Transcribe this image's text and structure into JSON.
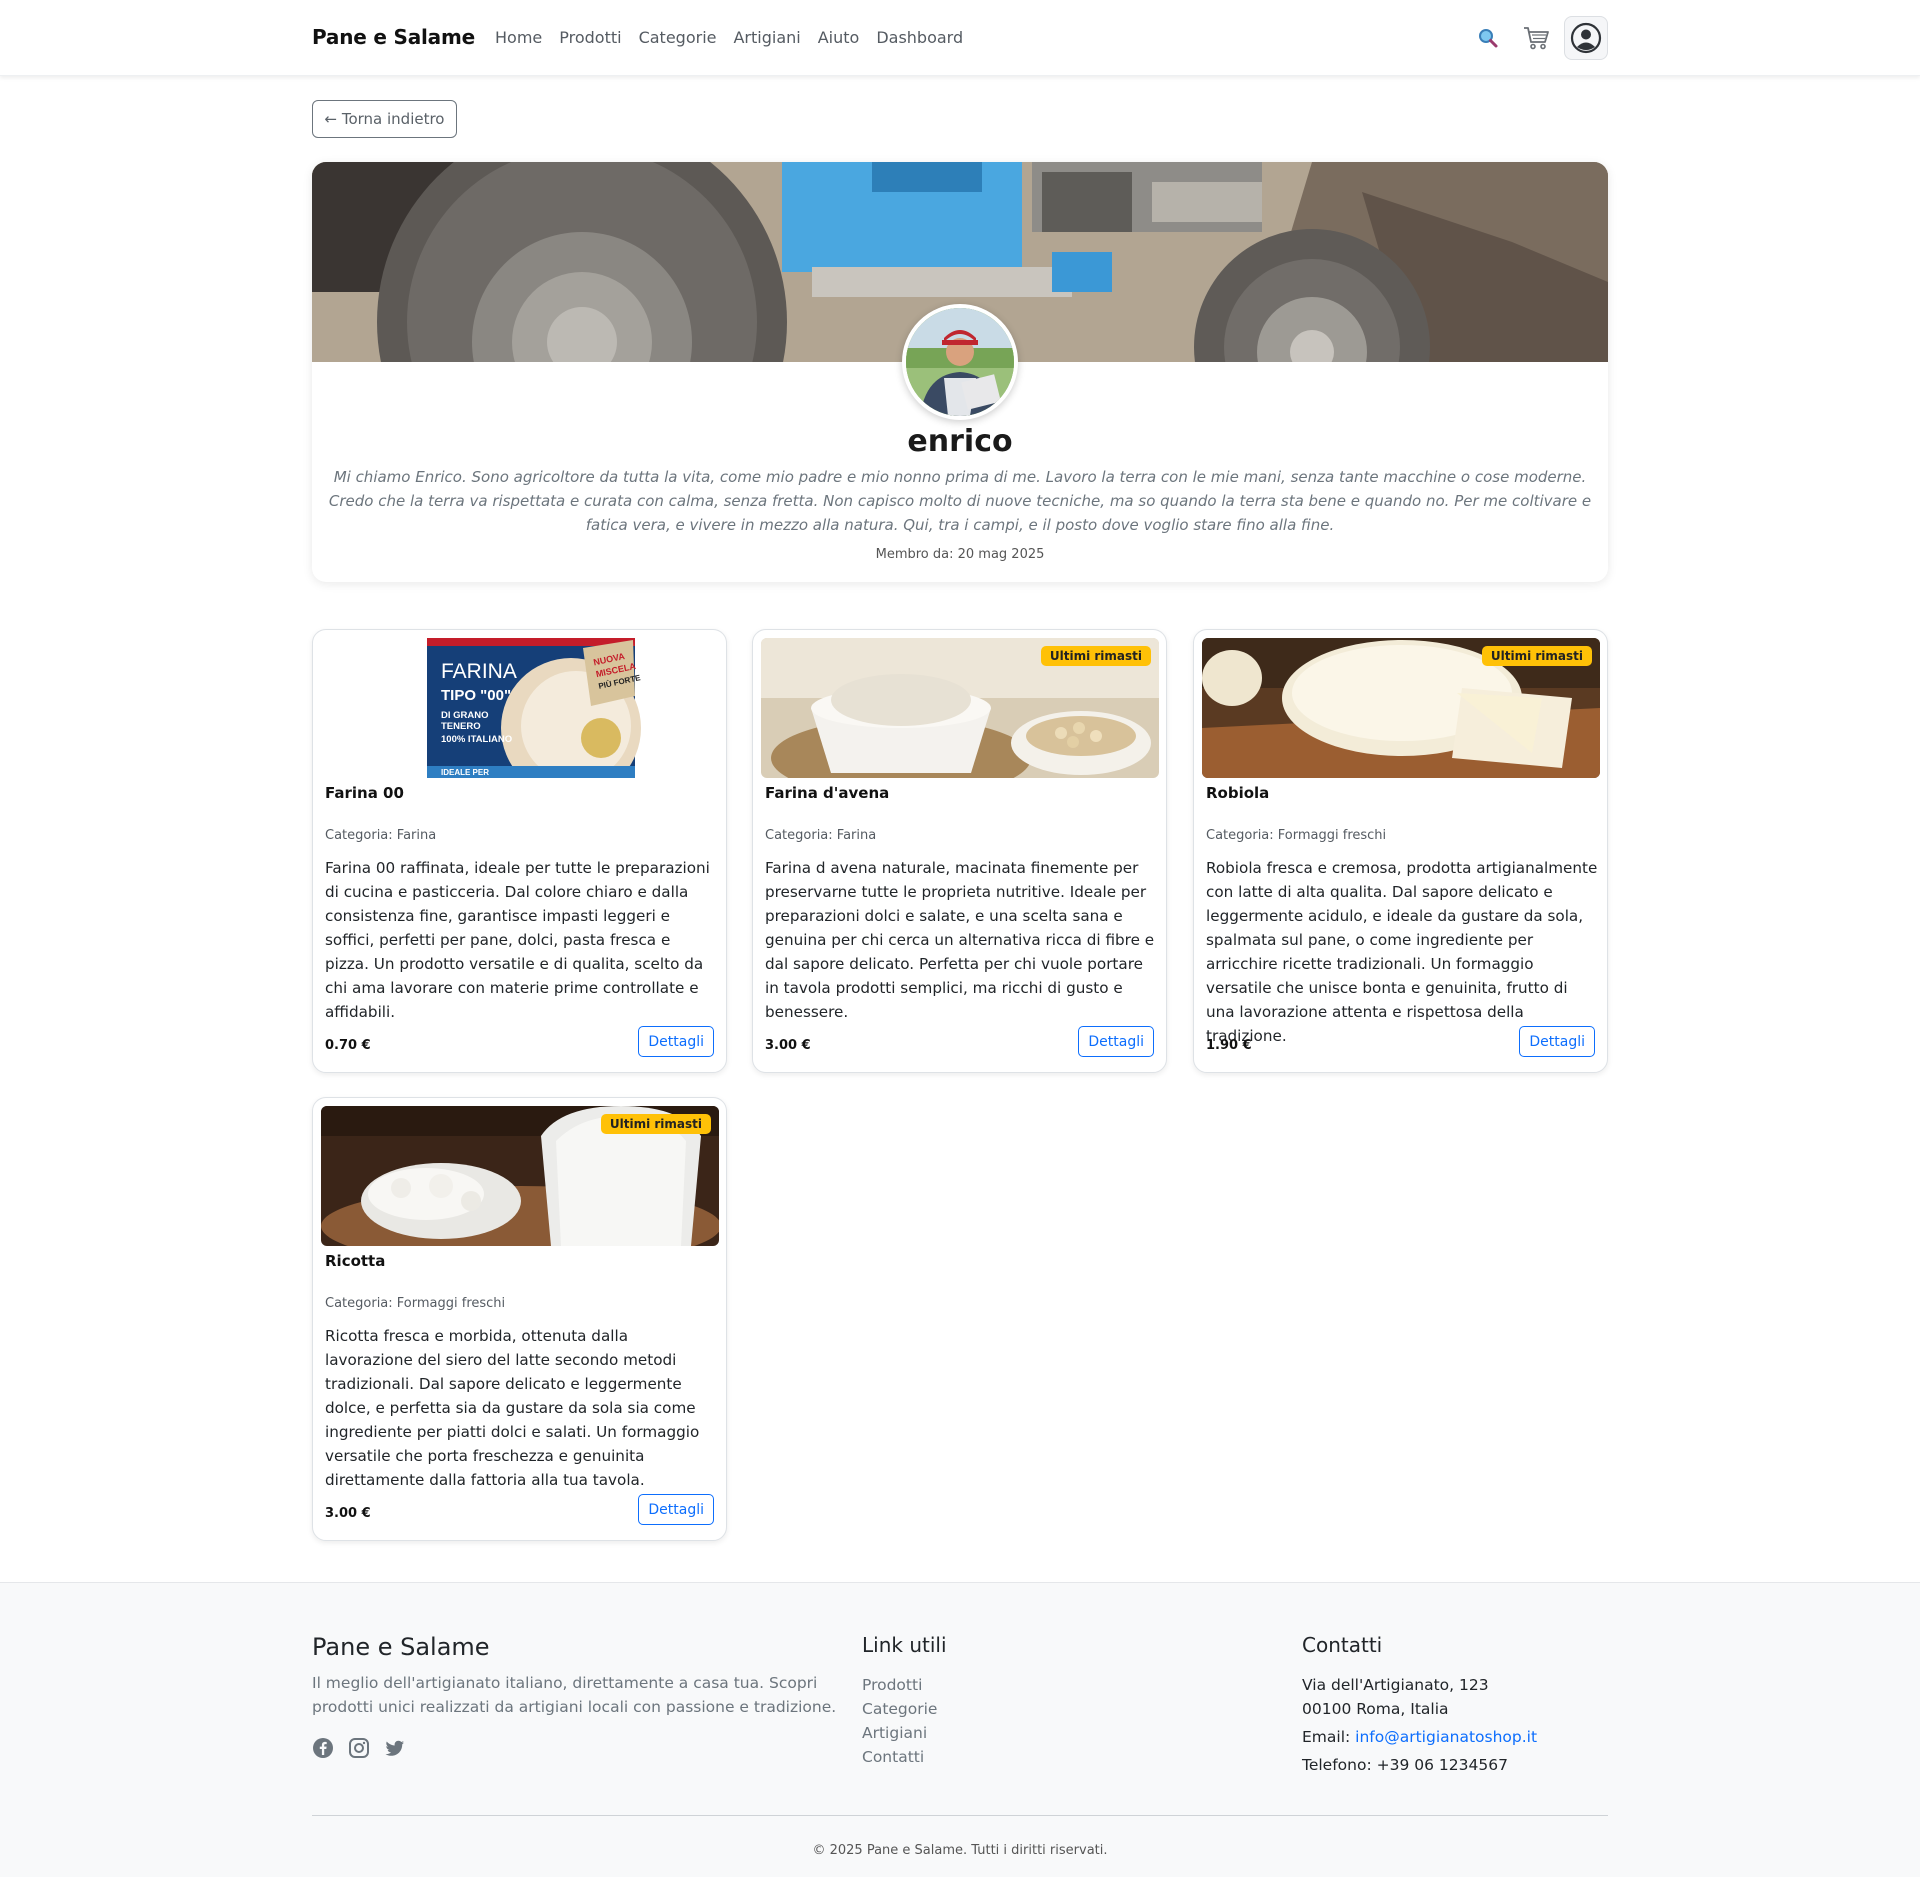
{
  "navbar": {
    "brand": "Pane e Salame",
    "links": [
      "Home",
      "Prodotti",
      "Categorie",
      "Artigiani",
      "Aiuto",
      "Dashboard"
    ]
  },
  "back_button": "← Torna indietro",
  "profile": {
    "name": "enrico",
    "bio": "Mi chiamo Enrico. Sono agricoltore da tutta la vita, come mio padre e mio nonno prima di me. Lavoro la terra con le mie mani, senza tante macchine o cose moderne. Credo che la terra va rispettata e curata con calma, senza fretta. Non capisco molto di nuove tecniche, ma so quando la terra sta bene e quando no. Per me coltivare e fatica vera, e vivere in mezzo alla natura. Qui, tra i campi, e il posto dove voglio stare fino alla fine.",
    "member_since": "Membro da: 20 mag 2025"
  },
  "products": [
    {
      "name": "Farina 00",
      "category": "Categoria: Farina",
      "description": "Farina 00 raffinata, ideale per tutte le preparazioni di cucina e pasticceria. Dal colore chiaro e dalla consistenza fine, garantisce impasti leggeri e soffici, perfetti per pane, dolci, pasta fresca e pizza. Un prodotto versatile e di qualita, scelto da chi ama lavorare con materie prime controllate e affidabili.",
      "price": "0.70 €",
      "button": "Dettagli",
      "badge": "",
      "package_text": [
        "FARINA",
        "TIPO \"00\"",
        "DI GRANO",
        "TENERO",
        "100% ITALIANO",
        "IDEALE PER",
        "NUOVA",
        "MISCELA",
        "PIÙ FORTE"
      ]
    },
    {
      "name": "Farina d'avena",
      "category": "Categoria: Farina",
      "description": "Farina d avena naturale, macinata finemente per preservarne tutte le proprieta nutritive. Ideale per preparazioni dolci e salate, e una scelta sana e genuina per chi cerca un alternativa ricca di fibre e dal sapore delicato. Perfetta per chi vuole portare in tavola prodotti semplici, ma ricchi di gusto e benessere.",
      "price": "3.00 €",
      "button": "Dettagli",
      "badge": "Ultimi rimasti"
    },
    {
      "name": "Robiola",
      "category": "Categoria: Formaggi freschi",
      "description": "Robiola fresca e cremosa, prodotta artigianalmente con latte di alta qualita. Dal sapore delicato e leggermente acidulo, e ideale da gustare da sola, spalmata sul pane, o come ingrediente per arricchire ricette tradizionali. Un formaggio versatile che unisce bonta e genuinita, frutto di una lavorazione attenta e rispettosa della tradizione.",
      "price": "1.90 €",
      "button": "Dettagli",
      "badge": "Ultimi rimasti"
    },
    {
      "name": "Ricotta",
      "category": "Categoria: Formaggi freschi",
      "description": "Ricotta fresca e morbida, ottenuta dalla lavorazione del siero del latte secondo metodi tradizionali. Dal sapore delicato e leggermente dolce, e perfetta sia da gustare da sola sia come ingrediente per piatti dolci e salati. Un formaggio versatile che porta freschezza e genuinita direttamente dalla fattoria alla tua tavola.",
      "price": "3.00 €",
      "button": "Dettagli",
      "badge": "Ultimi rimasti"
    }
  ],
  "footer": {
    "brand": "Pane e Salame",
    "description": "Il meglio dell'artigianato italiano, direttamente a casa tua. Scopri prodotti unici realizzati da artigiani locali con passione e tradizione.",
    "social_icons": [
      "facebook-icon",
      "instagram-icon",
      "twitter-icon"
    ],
    "links_title": "Link utili",
    "links": [
      "Prodotti",
      "Categorie",
      "Artigiani",
      "Contatti"
    ],
    "contacts_title": "Contatti",
    "address_line1": "Via dell'Artigianato, 123",
    "address_line2": "00100 Roma, Italia",
    "email_label": "Email: ",
    "email": "info@artigianatoshop.it",
    "phone": "Telefono: +39 06 1234567",
    "copyright": "© 2025 Pane e Salame. Tutti i diritti riservati."
  },
  "colors": {
    "accent": "#0d6efd",
    "badge": "#ffc107",
    "muted": "#6c757d"
  }
}
